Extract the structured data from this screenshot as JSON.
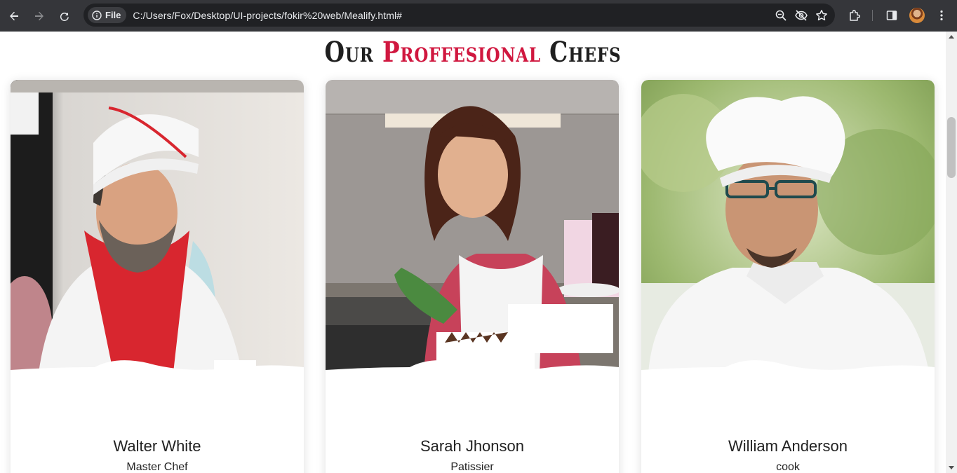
{
  "browser": {
    "file_chip_label": "File",
    "url": "C:/Users/Fox/Desktop/UI-projects/fokir%20web/Mealify.html#",
    "icons": [
      "back-arrow-icon",
      "forward-arrow-icon",
      "reload-icon",
      "info-icon",
      "zoom-icon",
      "eye-off-icon",
      "star-icon",
      "extensions-icon",
      "side-panel-icon",
      "profile-avatar",
      "more-menu-icon"
    ]
  },
  "heading": {
    "part1": "Our ",
    "accent": "Proffesional",
    "part2": " Chefs",
    "accent_color": "#d0173f"
  },
  "chefs": [
    {
      "name": "Walter White",
      "role": "Master Chef"
    },
    {
      "name": "Sarah Jhonson",
      "role": "Patissier"
    },
    {
      "name": "William Anderson",
      "role": "cook"
    }
  ]
}
